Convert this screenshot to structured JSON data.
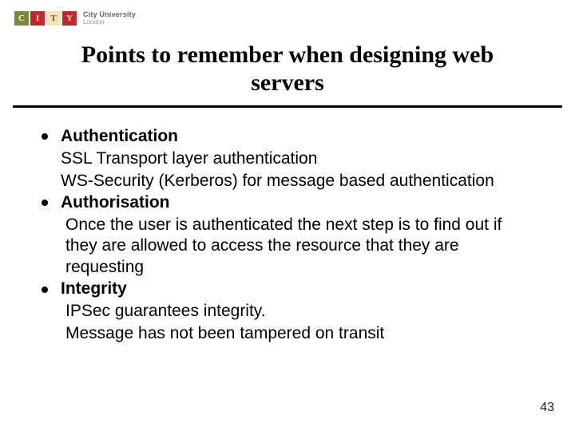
{
  "logo": {
    "letters": [
      "C",
      "I",
      "T",
      "Y"
    ],
    "line1": "City University",
    "line2": "London"
  },
  "title": "Points to remember when designing web servers",
  "bullets": [
    {
      "head": "Authentication",
      "lines": [
        "SSL Transport layer authentication",
        "WS-Security (Kerberos) for message based authentication"
      ]
    },
    {
      "head": "Authorisation",
      "lines": [
        "Once the user is authenticated the next step is to find out if they are allowed to access the resource that they are requesting"
      ]
    },
    {
      "head": "Integrity",
      "lines": [
        "IPSec guarantees integrity.",
        "Message has not been tampered on transit"
      ]
    }
  ],
  "page_number": "43"
}
